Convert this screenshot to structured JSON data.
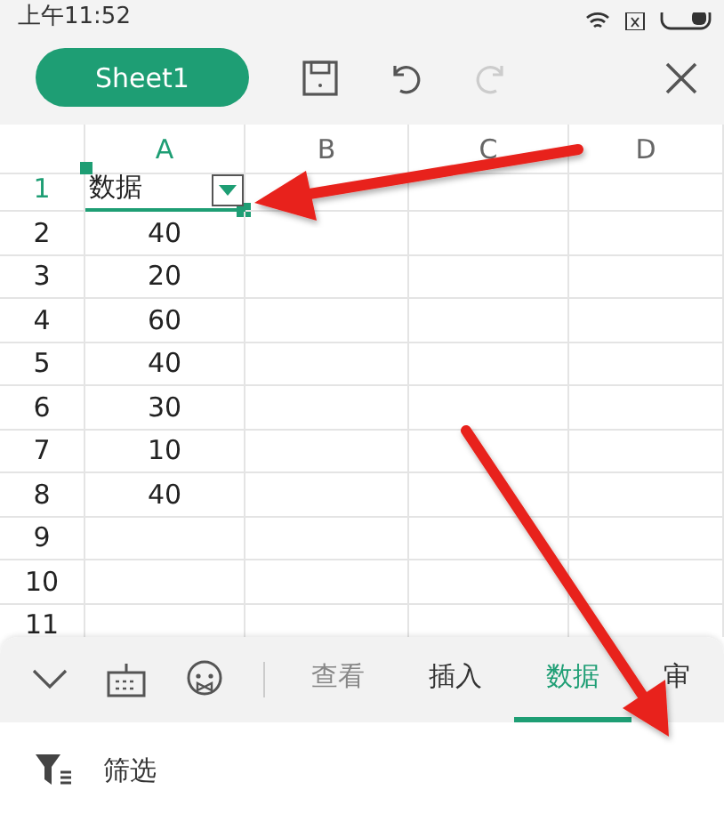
{
  "status_bar": {
    "time": "上午11:52"
  },
  "toolbar": {
    "sheet_button": "Sheet1"
  },
  "columns": [
    {
      "label": "A",
      "selected": true
    },
    {
      "label": "B",
      "selected": false
    },
    {
      "label": "C",
      "selected": false
    },
    {
      "label": "D",
      "selected": false
    }
  ],
  "rows": [
    {
      "number": "1",
      "selected": true,
      "filter": true,
      "cells": [
        {
          "value": "数据",
          "kind": "text"
        }
      ]
    },
    {
      "number": "2",
      "selected": false,
      "cells": [
        {
          "value": "40",
          "kind": "number"
        }
      ]
    },
    {
      "number": "3",
      "selected": false,
      "cells": [
        {
          "value": "20",
          "kind": "number"
        }
      ]
    },
    {
      "number": "4",
      "selected": false,
      "cells": [
        {
          "value": "60",
          "kind": "number"
        }
      ]
    },
    {
      "number": "5",
      "selected": false,
      "cells": [
        {
          "value": "40",
          "kind": "number"
        }
      ]
    },
    {
      "number": "6",
      "selected": false,
      "cells": [
        {
          "value": "30",
          "kind": "number"
        }
      ]
    },
    {
      "number": "7",
      "selected": false,
      "cells": [
        {
          "value": "10",
          "kind": "number"
        }
      ]
    },
    {
      "number": "8",
      "selected": false,
      "cells": [
        {
          "value": "40",
          "kind": "number"
        }
      ]
    },
    {
      "number": "9",
      "selected": false,
      "cells": []
    },
    {
      "number": "10",
      "selected": false,
      "cells": []
    },
    {
      "number": "11",
      "selected": false,
      "cells": []
    }
  ],
  "ribbon_tabs": [
    {
      "label": "查看",
      "selected": false
    },
    {
      "label": "插入",
      "selected": false
    },
    {
      "label": "数据",
      "selected": true
    },
    {
      "label": "审",
      "selected": false
    }
  ],
  "panel_items": [
    {
      "label": "筛选"
    }
  ]
}
